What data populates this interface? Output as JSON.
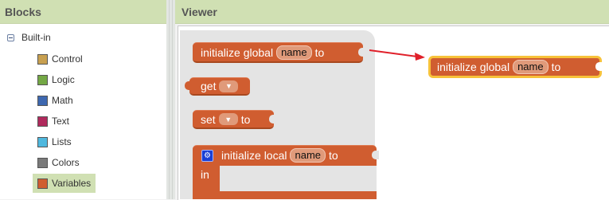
{
  "blocks_panel": {
    "title": "Blocks",
    "tree": {
      "root_label": "Built-in",
      "categories": [
        {
          "label": "Control",
          "color": "#c8a050"
        },
        {
          "label": "Logic",
          "color": "#74a845"
        },
        {
          "label": "Math",
          "color": "#3e68b0"
        },
        {
          "label": "Text",
          "color": "#b02a5d"
        },
        {
          "label": "Lists",
          "color": "#4fb8de"
        },
        {
          "label": "Colors",
          "color": "#7a7a7a"
        },
        {
          "label": "Variables",
          "color": "#d05d30",
          "selected": true
        }
      ]
    }
  },
  "viewer": {
    "title": "Viewer",
    "flyout_blocks": {
      "init_global": {
        "prefix": "initialize global",
        "field": "name",
        "suffix": "to"
      },
      "get": {
        "label": "get"
      },
      "set": {
        "label": "set",
        "suffix": "to"
      },
      "init_local": {
        "prefix": "initialize local",
        "field": "name",
        "suffix": "to",
        "in_label": "in"
      }
    },
    "placed_block": {
      "prefix": "initialize global",
      "field": "name",
      "suffix": "to"
    },
    "arrow_color": "#e0202a"
  }
}
